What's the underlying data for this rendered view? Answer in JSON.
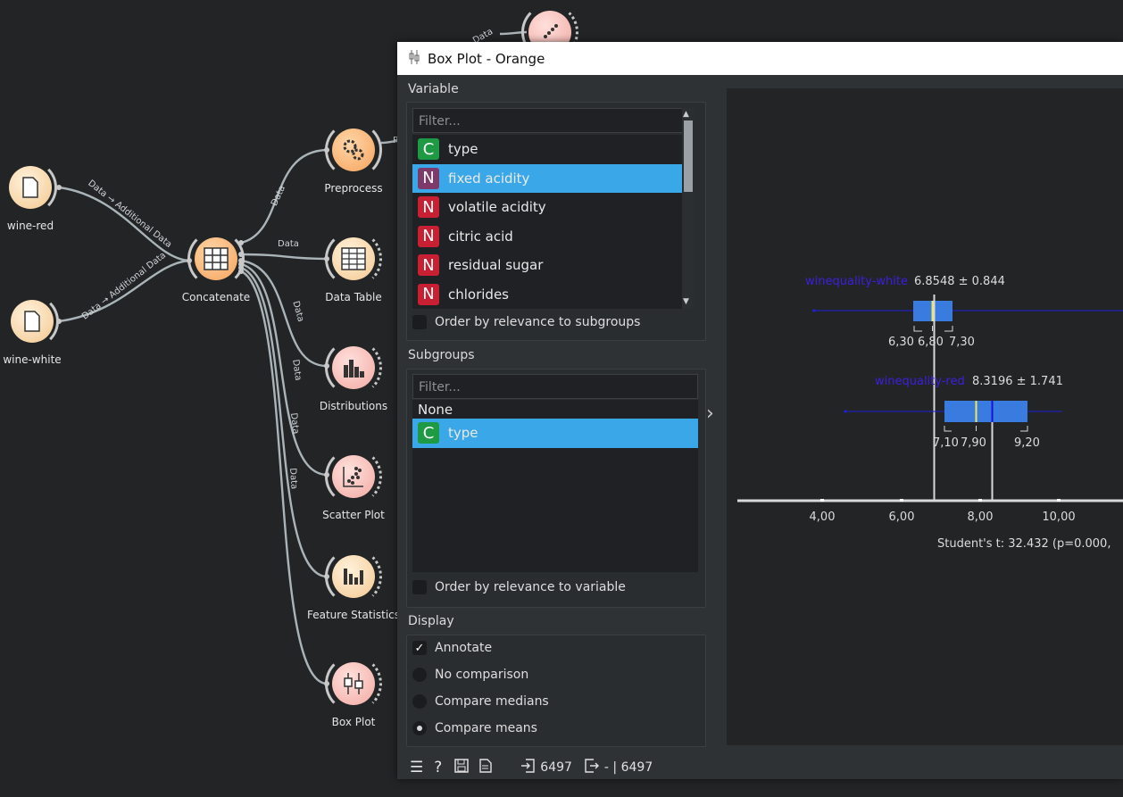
{
  "canvas": {
    "nodes": {
      "wine_red": "wine-red",
      "wine_white": "wine-white",
      "concatenate": "Concatenate",
      "preprocess": "Preprocess",
      "data_table": "Data Table",
      "distributions": "Distributions",
      "scatter_plot": "Scatter Plot",
      "feature_statistics": "Feature Statistics",
      "box_plot": "Box Plot"
    },
    "edge_labels": {
      "red_link": "Data → Additional Data",
      "white_link": "Data → Additional Data",
      "data": "Data",
      "data_partial": "Data",
      "preprocess_out": "P"
    }
  },
  "window": {
    "title": "Box Plot - Orange",
    "variable": {
      "section": "Variable",
      "filter_placeholder": "Filter...",
      "items": [
        {
          "kind": "C",
          "label": "type"
        },
        {
          "kind": "N",
          "label": "fixed acidity"
        },
        {
          "kind": "N",
          "label": "volatile acidity"
        },
        {
          "kind": "N",
          "label": "citric acid"
        },
        {
          "kind": "N",
          "label": "residual sugar"
        },
        {
          "kind": "N",
          "label": "chlorides"
        }
      ],
      "selected_index": 1,
      "order_checkbox": "Order by relevance to subgroups"
    },
    "subgroups": {
      "section": "Subgroups",
      "filter_placeholder": "Filter...",
      "none_label": "None",
      "items": [
        {
          "kind": "C",
          "label": "type"
        }
      ],
      "order_checkbox": "Order by relevance to variable"
    },
    "display": {
      "section": "Display",
      "annotate": "Annotate",
      "annotate_checked": true,
      "options": [
        "No comparison",
        "Compare medians",
        "Compare means"
      ],
      "selected_option": "Compare means"
    },
    "plot": {
      "white": {
        "name": "winequality-white",
        "stat": "6.8548 ± 0.844",
        "q1": "6,30",
        "median": "6,80",
        "q3": "7,30"
      },
      "red": {
        "name": "winequality-red",
        "stat": "8.3196 ± 1.741",
        "q1": "7,10",
        "median": "7,90",
        "q3": "9,20"
      },
      "axis_ticks": [
        "4,00",
        "6,00",
        "8,00",
        "10,00"
      ],
      "test_text": "Student's t: 32.432 (p=0.000,",
      "colors": {
        "box": "#3a7be0",
        "label": "#3b1fe0",
        "median": "#f0e65a",
        "mean": "#1414d8"
      }
    },
    "statusbar": {
      "input_count": "6497",
      "output_text": "- | 6497"
    }
  }
}
